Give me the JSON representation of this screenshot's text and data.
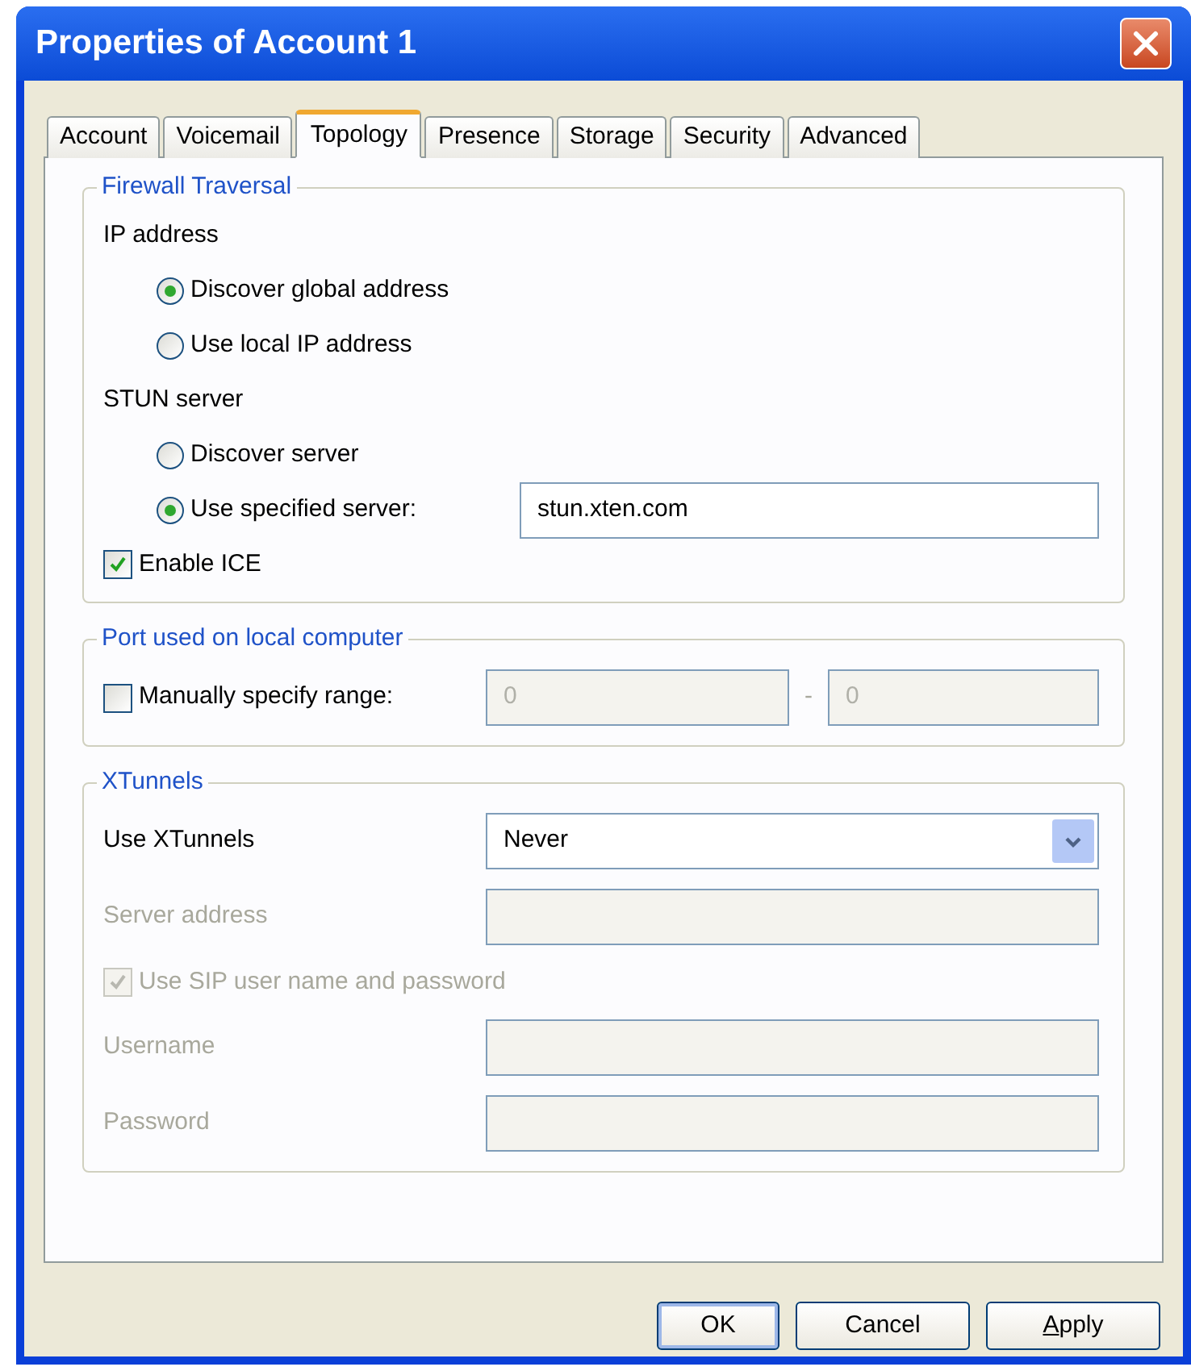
{
  "window": {
    "title": "Properties of Account 1"
  },
  "tabs": [
    {
      "label": "Account",
      "selected": false
    },
    {
      "label": "Voicemail",
      "selected": false
    },
    {
      "label": "Topology",
      "selected": true
    },
    {
      "label": "Presence",
      "selected": false
    },
    {
      "label": "Storage",
      "selected": false
    },
    {
      "label": "Security",
      "selected": false
    },
    {
      "label": "Advanced",
      "selected": false
    }
  ],
  "groups": [
    {
      "title": "Firewall Traversal",
      "rows": [
        {
          "kind": "label",
          "text": "IP address"
        },
        {
          "kind": "radio",
          "label": "Discover global address",
          "selected": true
        },
        {
          "kind": "radio",
          "label": "Use local IP address",
          "selected": false
        },
        {
          "kind": "label",
          "text": "STUN server"
        },
        {
          "kind": "radio",
          "label": "Discover server",
          "selected": false
        },
        {
          "kind": "radio",
          "label": "Use specified server:",
          "selected": true,
          "value": "stun.xten.com"
        },
        {
          "kind": "checkbox",
          "label": "Enable ICE",
          "checked": true,
          "disabled": false
        }
      ]
    },
    {
      "title": "Port used on local computer",
      "rows": [
        {
          "kind": "range",
          "label": "Manually specify range:",
          "checked": false,
          "from": "0",
          "separator": "-",
          "to": "0",
          "disabled": true
        }
      ]
    },
    {
      "title": "XTunnels",
      "rows": [
        {
          "kind": "select",
          "label": "Use XTunnels",
          "value": "Never",
          "disabled": false
        },
        {
          "kind": "text",
          "label": "Server address",
          "disabled": true
        },
        {
          "kind": "checkbox",
          "label": "Use SIP user name and password",
          "checked": true,
          "disabled": true
        },
        {
          "kind": "text",
          "label": "Username",
          "disabled": true
        },
        {
          "kind": "text",
          "label": "Password",
          "disabled": true
        }
      ]
    }
  ],
  "buttons": [
    {
      "label": "OK",
      "default": true
    },
    {
      "label": "Cancel",
      "default": false
    },
    {
      "label": "Apply",
      "default": false,
      "mnemonic": true
    }
  ]
}
